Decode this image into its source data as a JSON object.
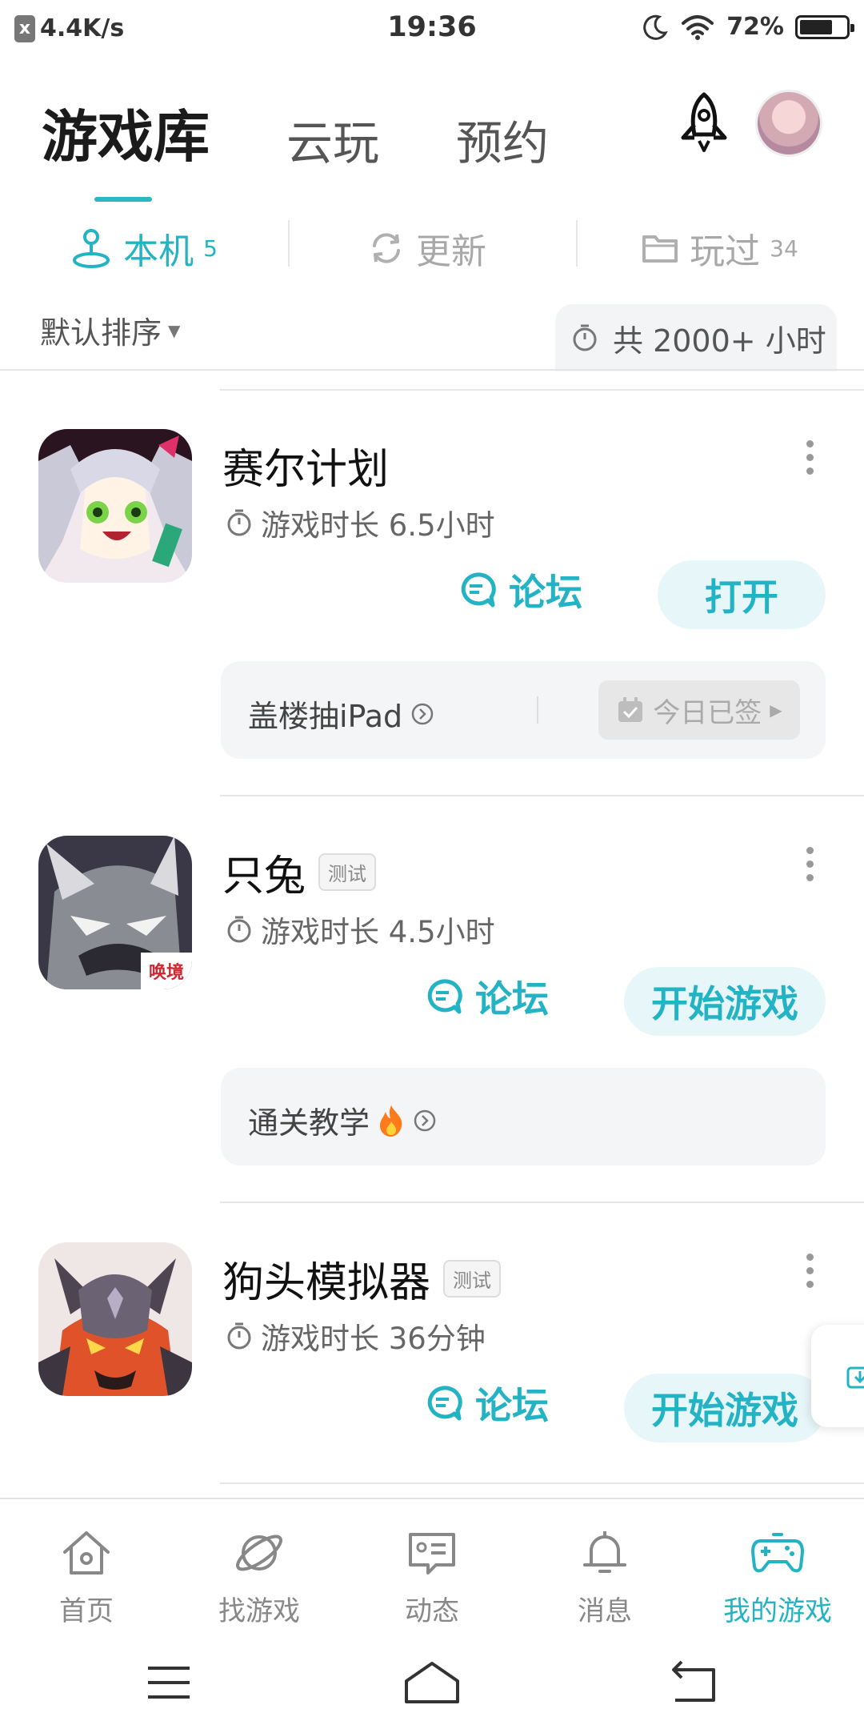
{
  "status_bar": {
    "notification_badge": "x",
    "speed": "4.4K/s",
    "time": "19:36",
    "battery_percent_text": "72%",
    "battery_level": 0.72
  },
  "top_tabs": [
    {
      "label": "游戏库",
      "active": true
    },
    {
      "label": "云玩",
      "active": false
    },
    {
      "label": "预约",
      "active": false
    }
  ],
  "sub_tabs": [
    {
      "label": "本机",
      "count": "5",
      "icon": "joystick-icon",
      "active": true
    },
    {
      "label": "更新",
      "count": "",
      "icon": "refresh-icon",
      "active": false
    },
    {
      "label": "玩过",
      "count": "34",
      "icon": "folder-icon",
      "active": false
    }
  ],
  "sort": {
    "label": "默认排序"
  },
  "total_time": "共 2000+ 小时",
  "accent_color": "#24b3c4",
  "games": [
    {
      "name": "赛尔计划",
      "tag": "",
      "playtime": "游戏时长 6.5小时",
      "forum_label": "论坛",
      "action_label": "打开",
      "extra": {
        "text": "盖楼抽iPad",
        "sign_label": "今日已签"
      }
    },
    {
      "name": "只兔",
      "tag": "测试",
      "playtime": "游戏时长 4.5小时",
      "forum_label": "论坛",
      "action_label": "开始游戏",
      "icon_badge": "唤境",
      "extra": {
        "text": "通关教学",
        "sign_label": ""
      }
    },
    {
      "name": "狗头模拟器",
      "tag": "测试",
      "playtime": "游戏时长 36分钟",
      "forum_label": "论坛",
      "action_label": "开始游戏"
    }
  ],
  "bottom_nav": [
    {
      "label": "首页",
      "icon": "home-icon",
      "active": false
    },
    {
      "label": "找游戏",
      "icon": "planet-icon",
      "active": false
    },
    {
      "label": "动态",
      "icon": "feed-icon",
      "active": false
    },
    {
      "label": "消息",
      "icon": "bell-icon",
      "active": false
    },
    {
      "label": "我的游戏",
      "icon": "gamepad-icon",
      "active": true
    }
  ]
}
